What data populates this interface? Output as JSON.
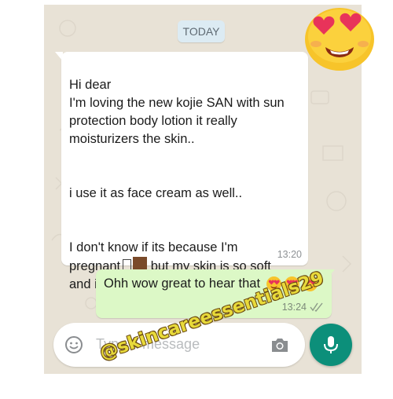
{
  "date_chip": "TODAY",
  "incoming": {
    "line1": "Hi dear\nI'm loving the new kojie SAN with sun protection body lotion it really moisturizers the skin..",
    "line2": "i use it as face cream as well..",
    "line3_a": "I don't know if its because I'm\npregnant",
    "line3_b": "but my skin is so soft\nand it's glowing and lighter  to.",
    "time": "13:20"
  },
  "outgoing": {
    "text": "Ohh wow great to hear that",
    "time": "13:24",
    "emoji": "heart-eyes-emoji",
    "emoji_count": 3
  },
  "input": {
    "placeholder": "Type a message"
  },
  "watermark": "@skincareessentials29",
  "colors": {
    "chat_bg": "#e8e2d6",
    "incoming_bubble": "#ffffff",
    "outgoing_bubble": "#dcf8c6",
    "mic_button": "#0c8f7a",
    "watermark": "#e8da3a"
  }
}
